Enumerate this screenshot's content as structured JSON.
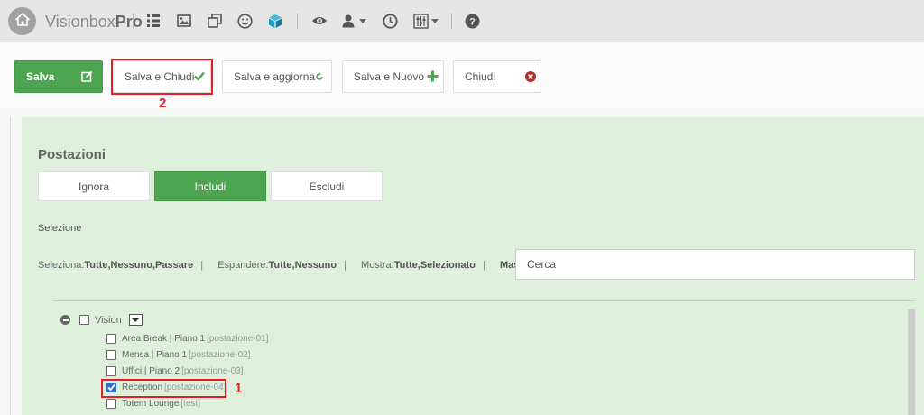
{
  "app": {
    "brand_regular": "Visionbox",
    "brand_bold": "Pro"
  },
  "nav_icons": [
    "list-icon",
    "image-icon",
    "copy-icon",
    "smiley-icon",
    "cube-icon",
    "eye-icon",
    "user-icon",
    "clock-icon",
    "sliders-icon",
    "help-icon"
  ],
  "toolbar": {
    "salva": "Salva",
    "salva_chiudi": "Salva e Chiudi",
    "salva_aggiorna": "Salva e aggiorna",
    "salva_nuovo": "Salva e Nuovo",
    "chiudi": "Chiudi"
  },
  "annotations": {
    "step1": "1",
    "step2": "2",
    "color": "#e31e24"
  },
  "panel": {
    "title": "Postazioni",
    "segments": [
      "Ignora",
      "Includi",
      "Escludi"
    ],
    "active_segment": "Includi",
    "selection_label": "Selezione",
    "seleziona_label": "Seleziona:",
    "seleziona_links": "Tutte,Nessuno,Passare",
    "espandere_label": "Espandere:",
    "espandere_links": "Tutte,Nessuno",
    "mostra_label": "Mostra:",
    "mostra_links": "Tutte,Selezionato",
    "separator": "|",
    "massimizza": "Massimizza",
    "search_placeholder": "Cerca"
  },
  "tree": {
    "root": {
      "label": "Vision",
      "checked": false
    },
    "items": [
      {
        "label": "Area Break | Piano 1",
        "tag": "[postazione-01]",
        "checked": false
      },
      {
        "label": "Mensa | Piano 1",
        "tag": "[postazione-02]",
        "checked": false
      },
      {
        "label": "Uffici | Piano 2",
        "tag": "[postazione-03]",
        "checked": false
      },
      {
        "label": "Reception",
        "tag": "[postazione-04]",
        "checked": true
      },
      {
        "label": "Totem Lounge",
        "tag": "[test]",
        "checked": false
      }
    ]
  },
  "colors": {
    "accent_green": "#4ea551",
    "panel_bg": "#deefdc",
    "cube_blue": "#1aa1c9",
    "chiudi_red": "#b52a2a"
  }
}
